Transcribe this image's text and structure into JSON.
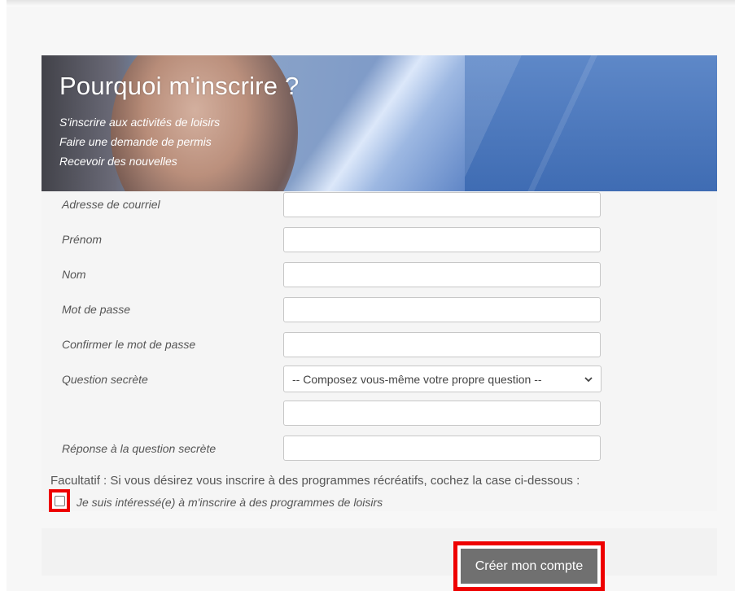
{
  "banner": {
    "title": "Pourquoi m'inscrire ?",
    "benefits": [
      "S'inscrire aux activités de loisirs",
      "Faire une demande de permis",
      "Recevoir des nouvelles"
    ]
  },
  "form": {
    "fields": [
      {
        "label": "Adresse de courriel",
        "value": ""
      },
      {
        "label": "Prénom",
        "value": ""
      },
      {
        "label": "Nom",
        "value": ""
      },
      {
        "label": "Mot de passe",
        "value": ""
      },
      {
        "label": "Confirmer le mot de passe",
        "value": ""
      }
    ],
    "secret_question": {
      "label": "Question secrète",
      "selected": "-- Composez vous-même votre propre question --",
      "custom_value": ""
    },
    "secret_answer": {
      "label": "Réponse à la question secrète",
      "value": ""
    },
    "optional_note": "Facultatif : Si vous désirez vous inscrire à des programmes récréatifs, cochez la case ci-dessous :",
    "interest_checkbox": {
      "label": "Je suis intéressé(e) à m'inscrire à des programmes de loisirs",
      "checked": false
    },
    "submit_label": "Créer mon compte"
  },
  "colors": {
    "highlight": "#ee0000",
    "button_bg": "#707070",
    "banner_blue": "#4a72b7"
  },
  "icons": {
    "select_arrow": "chevron-down-icon"
  }
}
